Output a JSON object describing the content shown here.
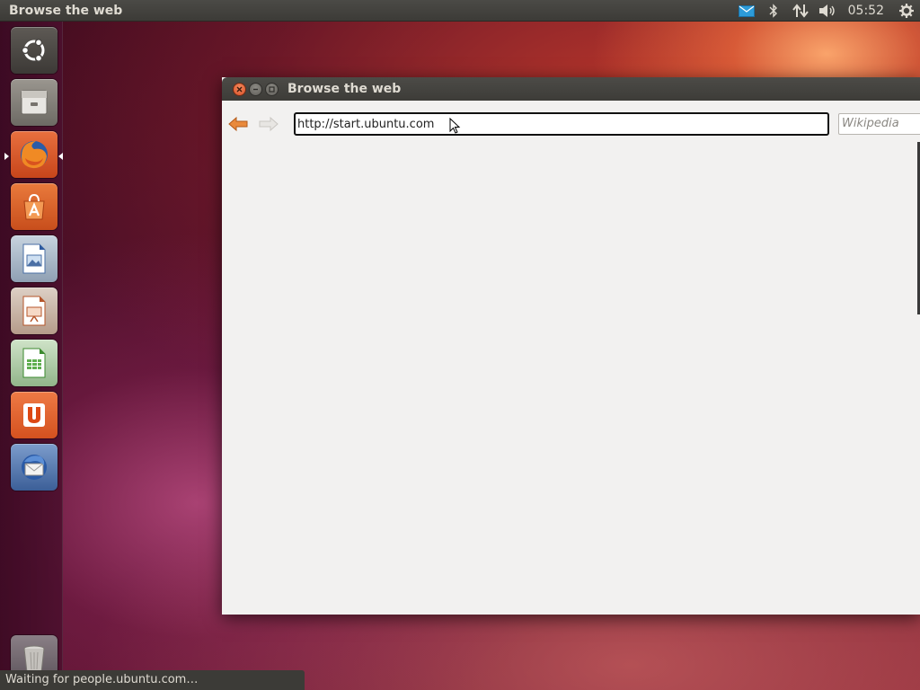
{
  "panel": {
    "title": "Browse the web",
    "clock": "05:52",
    "indicators": [
      "mail-icon",
      "bluetooth-icon",
      "network-icon",
      "volume-icon",
      "gear-icon"
    ]
  },
  "launcher": {
    "items": [
      {
        "name": "ubuntu-dash-icon"
      },
      {
        "name": "files-icon"
      },
      {
        "name": "firefox-icon",
        "active": true
      },
      {
        "name": "software-center-icon"
      },
      {
        "name": "libreoffice-writer-icon"
      },
      {
        "name": "libreoffice-impress-icon"
      },
      {
        "name": "libreoffice-calc-icon"
      },
      {
        "name": "ubuntu-one-icon"
      },
      {
        "name": "thunderbird-icon"
      },
      {
        "name": "trash-icon"
      }
    ]
  },
  "window": {
    "title": "Browse the web",
    "url": "http://start.ubuntu.com",
    "search_placeholder": "Wikipedia"
  },
  "status": {
    "text": "Waiting for people.ubuntu.com…"
  },
  "colors": {
    "accent": "#e95420",
    "panel": "#3c3b37"
  }
}
